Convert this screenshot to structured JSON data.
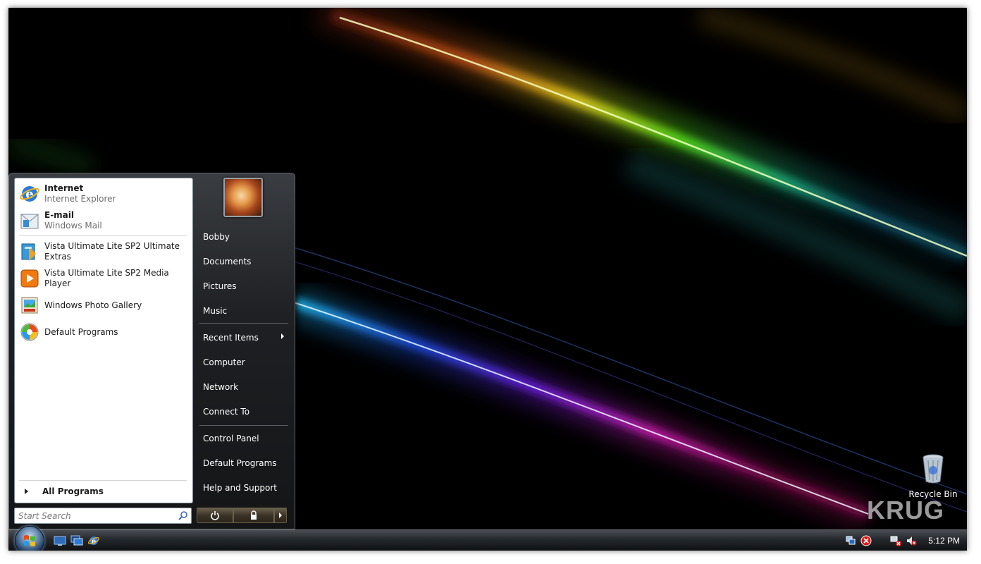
{
  "desktop": {
    "recycle_bin_label": "Recycle Bin",
    "watermark": "KRUG"
  },
  "start_menu": {
    "pinned": [
      {
        "title": "Internet",
        "subtitle": "Internet Explorer",
        "icon": "internet-explorer-icon"
      },
      {
        "title": "E-mail",
        "subtitle": "Windows Mail",
        "icon": "windows-mail-icon"
      }
    ],
    "recent": [
      {
        "title": "Vista Ultimate Lite SP2 Ultimate Extras",
        "icon": "ultimate-extras-icon"
      },
      {
        "title": "Vista Ultimate Lite SP2 Media Player",
        "icon": "media-player-icon"
      },
      {
        "title": "Windows Photo Gallery",
        "icon": "photo-gallery-icon"
      },
      {
        "title": "Default Programs",
        "icon": "default-programs-icon"
      }
    ],
    "all_programs": "All Programs",
    "search": {
      "placeholder": "Start Search"
    },
    "places": [
      "Bobby",
      "Documents",
      "Pictures",
      "Music",
      "Recent Items",
      "Computer",
      "Network",
      "Connect To",
      "Control Panel",
      "Default Programs",
      "Help and Support"
    ]
  },
  "taskbar": {
    "quick_launch": [
      "show-desktop-icon",
      "switch-windows-icon",
      "internet-explorer-icon"
    ],
    "tray_icons": [
      "network-icon",
      "security-alert-icon",
      "network-disconnected-icon",
      "volume-muted-icon"
    ],
    "clock": "5:12 PM"
  }
}
